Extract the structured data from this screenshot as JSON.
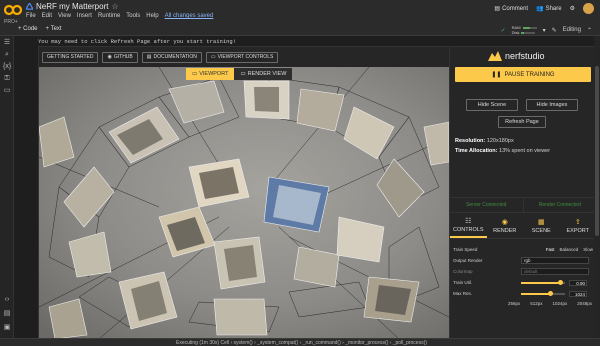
{
  "app": {
    "logo_text": "CO",
    "pro_label": "PRO+",
    "notebook_title": "NeRF my Matterport",
    "menu": [
      "File",
      "Edit",
      "View",
      "Insert",
      "Runtime",
      "Tools",
      "Help"
    ],
    "saved_status": "All changes saved",
    "comment_label": "Comment",
    "share_label": "Share",
    "add_code": "+ Code",
    "add_text": "+ Text",
    "ram_label": "RAM",
    "disk_label": "Disk",
    "ram_fraction": 0.55,
    "disk_fraction": 0.2,
    "editing_label": "Editing"
  },
  "output": {
    "message": "You may need to click Refresh Page after you start training!"
  },
  "viewer": {
    "topbar": [
      {
        "icon": "book-icon",
        "glyph": "",
        "label": "GETTING STARTED"
      },
      {
        "icon": "github-icon",
        "glyph": "◉",
        "label": "GITHUB"
      },
      {
        "icon": "document-icon",
        "glyph": "▤",
        "label": "DOCUMENTATION"
      },
      {
        "icon": "monitor-icon",
        "glyph": "▭",
        "label": "VIEWPORT CONTROLS"
      }
    ],
    "tabs": {
      "viewport": "VIEWPORT",
      "render_view": "RENDER VIEW"
    }
  },
  "panel": {
    "brand": "nerfstudio",
    "pause_label": "PAUSE TRAINING",
    "hide_scene": "Hide Scene",
    "hide_images": "Hide Images",
    "refresh_page": "Refresh Page",
    "resolution_label": "Resolution:",
    "resolution_value": "120x180px",
    "time_label": "Time Allocation:",
    "time_value": "13% spent on viewer",
    "server_status": "Server Connected",
    "render_status": "Render Connected",
    "tabs": [
      "CONTROLS",
      "RENDER",
      "SCENE",
      "EXPORT"
    ],
    "controls": {
      "train_speed_label": "Train Speed",
      "train_speed_options": [
        "Fast",
        "Balanced",
        "Slow"
      ],
      "output_render_label": "Output Render",
      "output_render_value": "rgb",
      "colormap_label": "Colormap",
      "colormap_value": "default",
      "train_util_label": "Train Util.",
      "train_util_value": "0.90",
      "max_res_label": "Max Res.",
      "max_res_value": "1024",
      "max_res_ticks": [
        "256px",
        "512px",
        "1024px",
        "2048px"
      ],
      "train_util_fraction": 0.9,
      "max_res_fraction": 0.66
    }
  },
  "status": {
    "text": "Executing (1m 30s)  Cell  ›  system()  ›  _system_compat()  ›  _run_command()  ›  _monitor_process()  ›  _poll_process()"
  }
}
